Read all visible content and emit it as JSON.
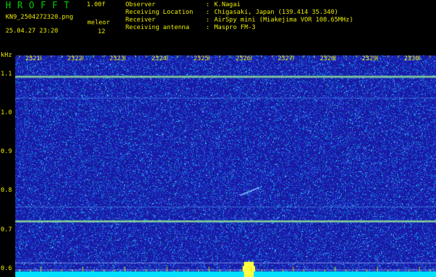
{
  "header": {
    "app_title": "HROFFT",
    "version": "1.00f",
    "filename": "KN9_2504272320.png",
    "datetime": "25.04.27 23:20",
    "meleor_label": "meleor",
    "meleor_count": "12"
  },
  "station_info": [
    {
      "key": "Observer",
      "value": "K.Nagai"
    },
    {
      "key": "Receiving Location",
      "value": "Chigasaki, Japan (139.414 35.340)"
    },
    {
      "key": "Receiver",
      "value": "AirSpy mini (Miakejima VOR 108.65MHz)"
    },
    {
      "key": "Receiving antenna",
      "value": "Maspro FM-3"
    }
  ],
  "chart_data": {
    "type": "heatmap",
    "y_unit": "kHz",
    "ylim": [
      0.58,
      1.15
    ],
    "y_ticks": [
      "1.1",
      "1.0",
      "0.9",
      "0.8",
      "0.7",
      "0.6"
    ],
    "x_ticks": [
      "2321",
      "2322",
      "2323",
      "2324",
      "2325",
      "2326",
      "2327",
      "2328",
      "2329",
      "2330"
    ],
    "xlim": [
      2320.4,
      2330.4
    ],
    "colors": {
      "background": "#1a1aa8",
      "noise": "#4a8cff",
      "signal": "#ffff40",
      "baseline": "#00e0ff"
    }
  }
}
